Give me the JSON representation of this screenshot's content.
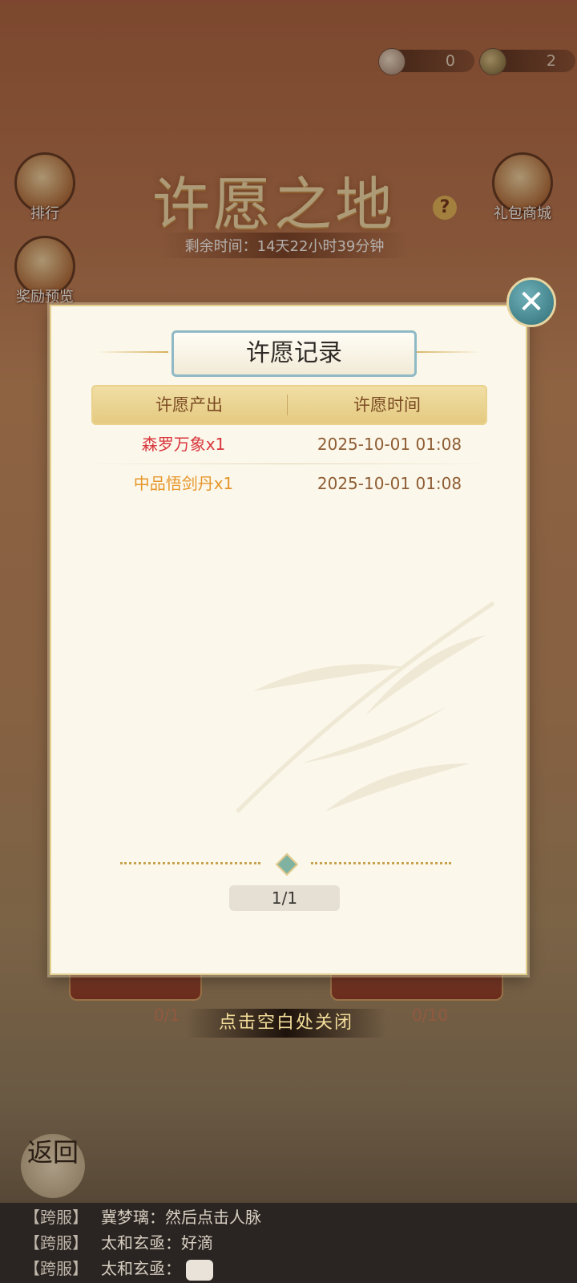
{
  "currency": [
    {
      "icon": "character-coin-icon",
      "value": "0"
    },
    {
      "icon": "ginkgo-leaf-icon",
      "value": "2"
    }
  ],
  "side_left": [
    {
      "label": "排行"
    },
    {
      "label": "奖励预览"
    }
  ],
  "side_right": [
    {
      "label": "礼包商城"
    }
  ],
  "background": {
    "title": "许愿之地",
    "remaining_time": "剩余时间：14天22小时39分钟"
  },
  "modal": {
    "title": "许愿记录",
    "columns": [
      "许愿产出",
      "许愿时间"
    ],
    "rows": [
      {
        "item": "森罗万象x1",
        "time": "2025-10-01   01:08",
        "color": "#d9363e"
      },
      {
        "item": "中品悟剑丹x1",
        "time": "2025-10-01   01:08",
        "color": "#e6962b"
      }
    ],
    "page": "1/1"
  },
  "counters": {
    "left": "0/1",
    "right": "0/10"
  },
  "close_hint": "点击空白处关闭",
  "back_label": "返回",
  "chat": [
    {
      "tag": "【跨服】",
      "text": "冀梦璃：然后点击人脉"
    },
    {
      "tag": "【跨服】",
      "text": "太和玄亟：好滴"
    },
    {
      "tag": "【跨服】",
      "text": "太和玄亟："
    }
  ]
}
